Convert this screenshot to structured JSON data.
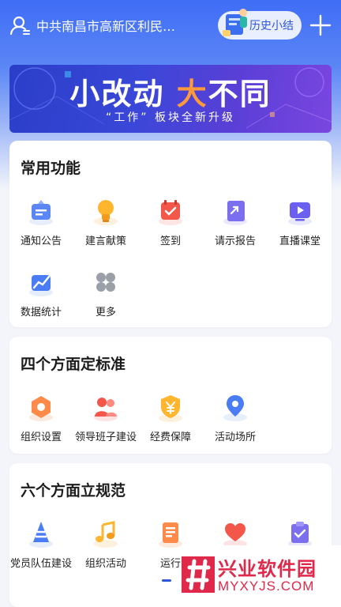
{
  "header": {
    "org_name": "中共南昌市高新区利民…",
    "history_label": "历史小结"
  },
  "banner": {
    "title_a": "小改动",
    "title_b": "大",
    "title_c": "不同",
    "subtitle": "“工作” 板块全新升级"
  },
  "common": {
    "title": "常用功能",
    "items": [
      {
        "label": "通知公告",
        "icon": "notice-icon"
      },
      {
        "label": "建言献策",
        "icon": "lightbulb-icon"
      },
      {
        "label": "签到",
        "icon": "calendar-checkin-icon"
      },
      {
        "label": "请示报告",
        "icon": "report-icon"
      },
      {
        "label": "直播课堂",
        "icon": "live-class-icon"
      },
      {
        "label": "数据统计",
        "icon": "statistics-icon"
      },
      {
        "label": "更多",
        "icon": "more-icon"
      }
    ]
  },
  "standards": {
    "title": "四个方面定标准",
    "items": [
      {
        "label": "组织设置",
        "icon": "organization-icon"
      },
      {
        "label": "领导班子建设",
        "icon": "leadership-icon"
      },
      {
        "label": "经费保障",
        "icon": "funding-shield-icon"
      },
      {
        "label": "活动场所",
        "icon": "location-icon"
      }
    ]
  },
  "norms": {
    "title": "六个方面立规范",
    "items": [
      {
        "label": "党员队伍建设",
        "icon": "cone-icon"
      },
      {
        "label": "组织活动",
        "icon": "music-icon"
      },
      {
        "label": "运行",
        "icon": "document-icon"
      },
      {
        "label": "",
        "icon": "heart-icon"
      },
      {
        "label": "",
        "icon": "checklist-icon"
      }
    ]
  },
  "watermark": {
    "cn": "兴业软件园",
    "en": "MYXYJS.COM"
  },
  "colors": {
    "primary": "#3f6df6",
    "accent": "#2f56d8",
    "watermark": "#e0284b"
  }
}
